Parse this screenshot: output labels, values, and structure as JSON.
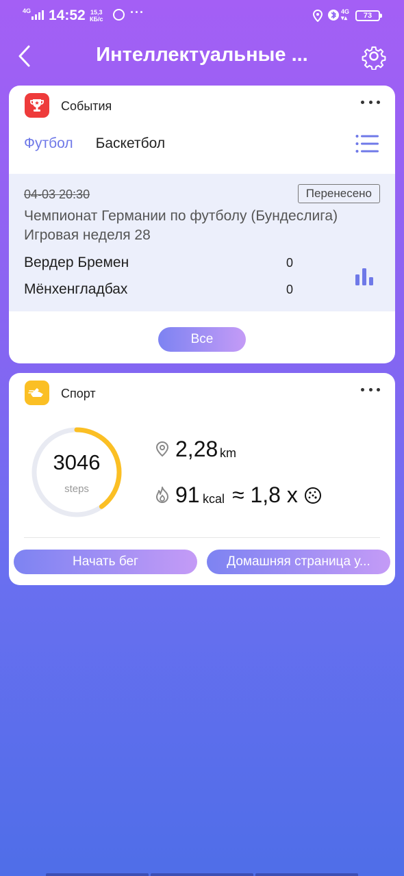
{
  "status_bar": {
    "network": "4G",
    "time": "14:52",
    "speed_value": "15,3",
    "speed_unit": "КБ/с",
    "more": "···",
    "network_right": "4G",
    "battery": "73"
  },
  "header": {
    "title": "Интеллектуальные ..."
  },
  "events_card": {
    "title": "События",
    "icon": "trophy-icon",
    "tabs": [
      {
        "label": "Футбол",
        "active": true
      },
      {
        "label": "Баскетбол",
        "active": false
      }
    ],
    "match": {
      "datetime": "04-03 20:30",
      "status": "Перенесено",
      "league": "Чемпионат Германии по футболу (Бундеслига) Игровая неделя 28",
      "team1": "Вердер Бремен",
      "score1": "0",
      "team2": "Мёнхенгладбах",
      "score2": "0"
    },
    "all_button": "Все"
  },
  "sport_card": {
    "title": "Спорт",
    "icon": "shoe-icon",
    "steps": "3046",
    "steps_unit": "steps",
    "steps_progress": 0.4,
    "distance": "2,28",
    "distance_unit": "km",
    "calories": "91",
    "calories_unit": "kcal",
    "equivalent": "≈ 1,8 x",
    "run_button": "Начать бег",
    "home_button": "Домашняя страница у..."
  },
  "colors": {
    "accent": "#6f79e8",
    "ring_progress": "#fbbf24",
    "ring_track": "#e8eaf2"
  }
}
